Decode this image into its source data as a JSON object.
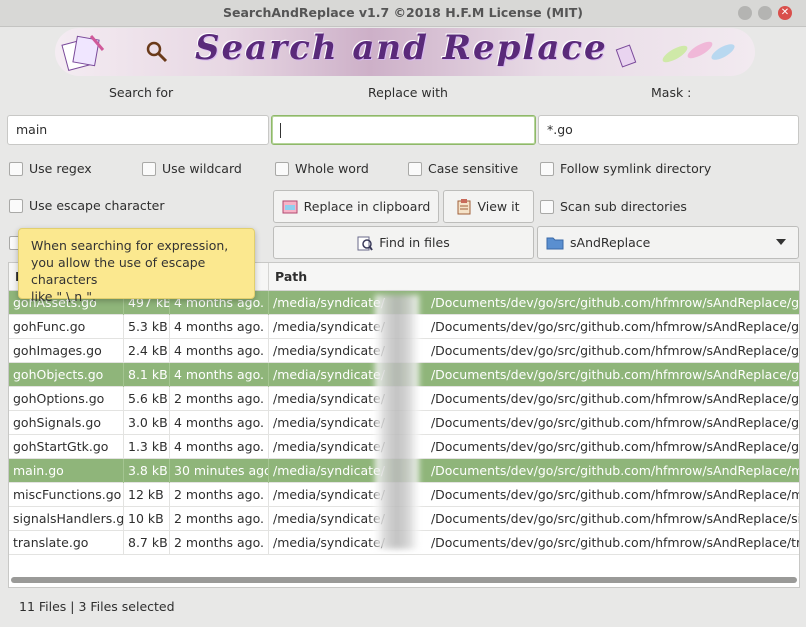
{
  "window": {
    "title": "SearchAndReplace v1.7  ©2018 H.F.M License (MIT)"
  },
  "banner": {
    "text": "Search and Replace"
  },
  "labels": {
    "search_for": "Search for",
    "replace_with": "Replace with",
    "mask": "Mask :"
  },
  "inputs": {
    "search_value": "main",
    "replace_value": "",
    "mask_value": "*.go"
  },
  "options": {
    "use_regex": "Use regex",
    "use_wildcard": "Use wildcard",
    "whole_word": "Whole word",
    "case_sensitive": "Case sensitive",
    "follow_symlink": "Follow symlink directory",
    "use_escape": "Use escape character",
    "scan_sub": "Scan sub directories"
  },
  "buttons": {
    "replace_clipboard": "Replace in clipboard",
    "view_it": "View it",
    "find_in_files": "Find in files"
  },
  "combo": {
    "selected": "sAndReplace"
  },
  "table": {
    "headers": {
      "name": "N",
      "path": "Path"
    },
    "rows": [
      {
        "name": "gohAssets.go",
        "size": "497 kB",
        "date": "4 months ago.",
        "path_a": "/media/syndicate/",
        "path_b": "/Documents/dev/go/src/github.com/hfmrow/sAndReplace/gohAssets.go",
        "selected": true
      },
      {
        "name": "gohFunc.go",
        "size": "5.3 kB",
        "date": "4 months ago.",
        "path_a": "/media/syndicate/",
        "path_b": "/Documents/dev/go/src/github.com/hfmrow/sAndReplace/gohFunc.go",
        "selected": false
      },
      {
        "name": "gohImages.go",
        "size": "2.4 kB",
        "date": "4 months ago.",
        "path_a": "/media/syndicate/",
        "path_b": "/Documents/dev/go/src/github.com/hfmrow/sAndReplace/gohImages.go",
        "selected": false
      },
      {
        "name": "gohObjects.go",
        "size": "8.1 kB",
        "date": "4 months ago.",
        "path_a": "/media/syndicate/",
        "path_b": "/Documents/dev/go/src/github.com/hfmrow/sAndReplace/gohObjects.go",
        "selected": true
      },
      {
        "name": "gohOptions.go",
        "size": "5.6 kB",
        "date": "2 months ago.",
        "path_a": "/media/syndicate/",
        "path_b": "/Documents/dev/go/src/github.com/hfmrow/sAndReplace/gohOptions.go",
        "selected": false
      },
      {
        "name": "gohSignals.go",
        "size": "3.0 kB",
        "date": "4 months ago.",
        "path_a": "/media/syndicate/",
        "path_b": "/Documents/dev/go/src/github.com/hfmrow/sAndReplace/gohSignals.go",
        "selected": false
      },
      {
        "name": "gohStartGtk.go",
        "size": "1.3 kB",
        "date": "4 months ago.",
        "path_a": "/media/syndicate/",
        "path_b": "/Documents/dev/go/src/github.com/hfmrow/sAndReplace/gohStartGtk.go",
        "selected": false
      },
      {
        "name": "main.go",
        "size": "3.8 kB",
        "date": "30 minutes ago.",
        "path_a": "/media/syndicate/",
        "path_b": "/Documents/dev/go/src/github.com/hfmrow/sAndReplace/main.go",
        "selected": true
      },
      {
        "name": "miscFunctions.go",
        "size": "12 kB",
        "date": "2 months ago.",
        "path_a": "/media/syndicate/",
        "path_b": "/Documents/dev/go/src/github.com/hfmrow/sAndReplace/miscFunctions.go",
        "selected": false
      },
      {
        "name": "signalsHandlers.go",
        "size": "10 kB",
        "date": "2 months ago.",
        "path_a": "/media/syndicate/",
        "path_b": "/Documents/dev/go/src/github.com/hfmrow/sAndReplace/signalsHandlers.go",
        "selected": false
      },
      {
        "name": "translate.go",
        "size": "8.7 kB",
        "date": "2 months ago.",
        "path_a": "/media/syndicate/",
        "path_b": "/Documents/dev/go/src/github.com/hfmrow/sAndReplace/translate.go",
        "selected": false
      }
    ]
  },
  "status": {
    "text": "11 Files | 3 Files selected"
  },
  "tooltip": {
    "line1": "When searching for expression,",
    "line2": "you allow the use of escape characters",
    "line3": "like \" \\ n \"."
  },
  "colors": {
    "selection": "#8fb57a",
    "tooltip": "#fbe88f",
    "close": "#d94f4b"
  }
}
